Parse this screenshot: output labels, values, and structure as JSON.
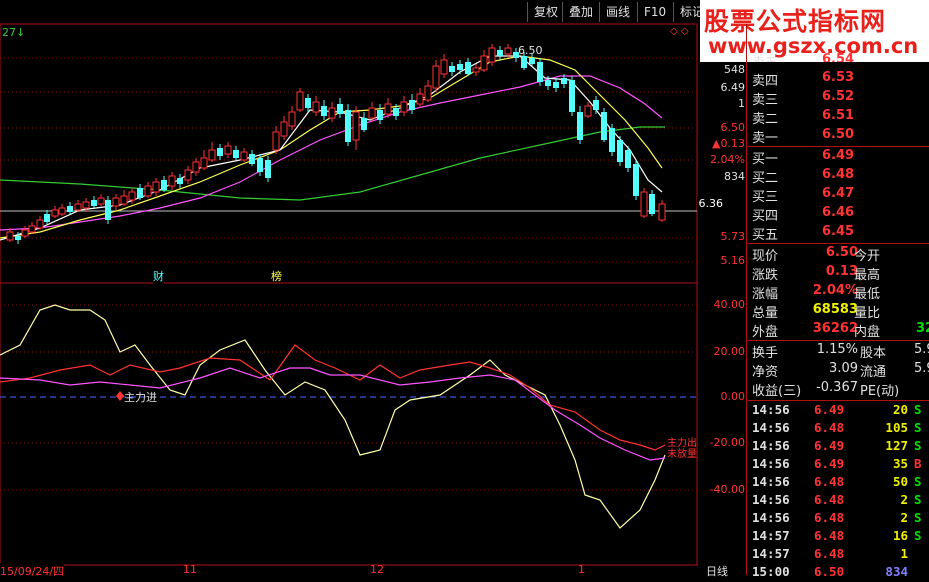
{
  "toolbar": {
    "buttons": [
      "复权",
      "叠加",
      "画线",
      "F10",
      "标记"
    ]
  },
  "logo": {
    "line1": "股票公式指标网",
    "line2": "www.gszx.com.cn",
    "color": "#e8211c"
  },
  "chart": {
    "corner_label": "27↓",
    "high_label": "6.50",
    "current_price_tag": "6.36",
    "diamond_label": "◇ ◇",
    "markers": [
      "财",
      "榜"
    ],
    "price_axis": [
      "548",
      "6.49",
      "1",
      "6.50",
      "▲0.13",
      "2.04%",
      "834",
      "5.73",
      "5.16"
    ],
    "indicator_axis": [
      "40.00",
      "20.00",
      "0.00",
      "-20.00",
      "-40.00"
    ],
    "indicator_label_left": "主力进",
    "indicator_label_right": "主力出 未放量",
    "date_axis": [
      "15/09/24/四",
      "11",
      "12",
      "1"
    ],
    "period_label": "日线",
    "colors": {
      "up": "#ff3333",
      "down": "#54ffff",
      "ma5": "#ffffff",
      "ma10": "#ffff55",
      "ma20": "#ff55ff",
      "ma60": "#33cc33",
      "zero_line": "#4466ff"
    }
  },
  "orderbook": {
    "asks": [
      {
        "label": "卖五",
        "price": "6.54"
      },
      {
        "label": "卖四",
        "price": "6.53"
      },
      {
        "label": "卖三",
        "price": "6.52"
      },
      {
        "label": "卖二",
        "price": "6.51"
      },
      {
        "label": "卖一",
        "price": "6.50"
      }
    ],
    "bids": [
      {
        "label": "买一",
        "price": "6.49"
      },
      {
        "label": "买二",
        "price": "6.48"
      },
      {
        "label": "买三",
        "price": "6.47"
      },
      {
        "label": "买四",
        "price": "6.46"
      },
      {
        "label": "买五",
        "price": "6.45"
      }
    ]
  },
  "quote": [
    {
      "l1": "现价",
      "v1": "6.50",
      "l2": "今开",
      "v2": ""
    },
    {
      "l1": "涨跌",
      "v1": "0.13",
      "l2": "最高",
      "v2": ""
    },
    {
      "l1": "涨幅",
      "v1": "2.04%",
      "l2": "最低",
      "v2": ""
    },
    {
      "l1": "总量",
      "v1": "68583",
      "l2": "量比",
      "v2": ""
    },
    {
      "l1": "外盘",
      "v1": "36262",
      "l2": "内盘",
      "v2": "32"
    }
  ],
  "fundamentals": [
    {
      "l1": "换手",
      "v1": "1.15%",
      "l2": "股本",
      "v2": "5.9"
    },
    {
      "l1": "净资",
      "v1": "3.09",
      "l2": "流通",
      "v2": "5.9"
    },
    {
      "l1": "收益(三)",
      "v1": "-0.367",
      "l2": "PE(动)",
      "v2": ""
    }
  ],
  "ticks": [
    {
      "time": "14:56",
      "price": "6.49",
      "vol": "20",
      "side": "S"
    },
    {
      "time": "14:56",
      "price": "6.48",
      "vol": "105",
      "side": "S"
    },
    {
      "time": "14:56",
      "price": "6.49",
      "vol": "127",
      "side": "S"
    },
    {
      "time": "14:56",
      "price": "6.49",
      "vol": "35",
      "side": "B"
    },
    {
      "time": "14:56",
      "price": "6.48",
      "vol": "50",
      "side": "S"
    },
    {
      "time": "14:56",
      "price": "6.48",
      "vol": "2",
      "side": "S"
    },
    {
      "time": "14:56",
      "price": "6.48",
      "vol": "2",
      "side": "S"
    },
    {
      "time": "14:57",
      "price": "6.48",
      "vol": "16",
      "side": "S"
    },
    {
      "time": "14:57",
      "price": "6.48",
      "vol": "1",
      "side": ""
    },
    {
      "time": "15:00",
      "price": "6.50",
      "vol": "834",
      "side": ""
    }
  ]
}
